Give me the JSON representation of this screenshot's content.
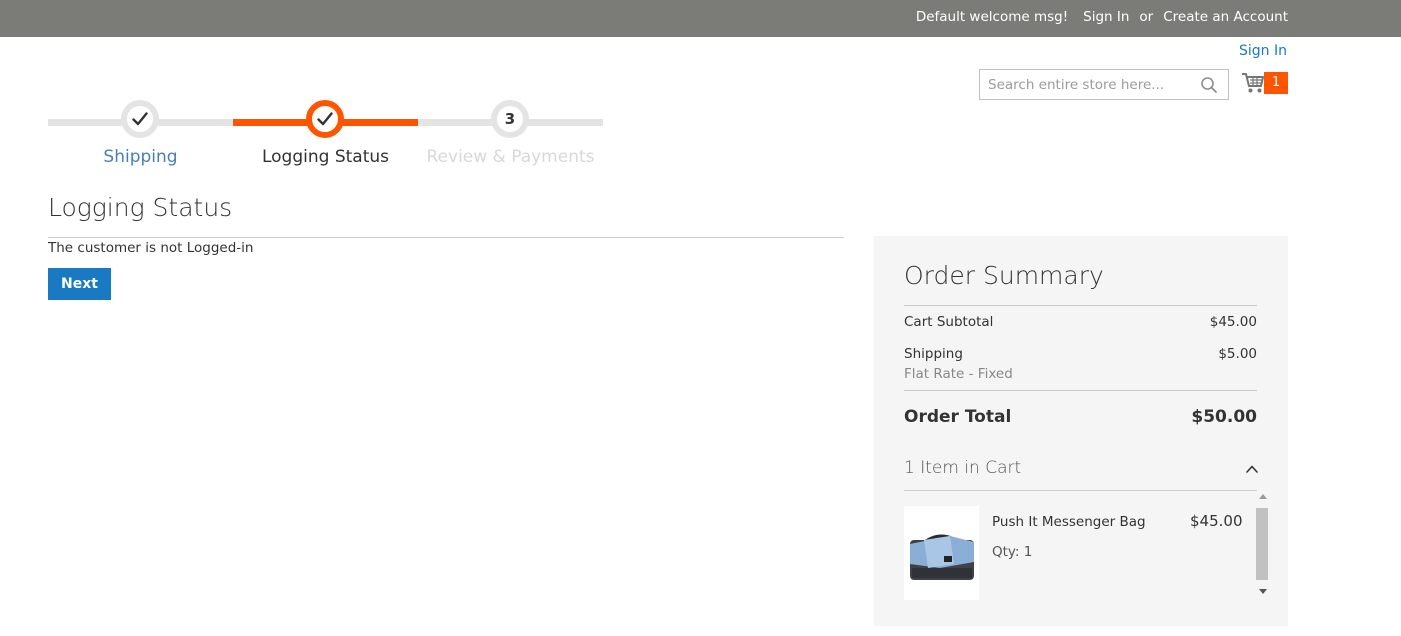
{
  "top_panel": {
    "welcome": "Default welcome msg!",
    "sign_in": "Sign In",
    "or": "or",
    "create_account": "Create an Account"
  },
  "header": {
    "sign_in": "Sign In",
    "search_placeholder": "Search entire store here...",
    "cart_count": "1",
    "accent_color": "#ff5501"
  },
  "progress": {
    "steps": [
      {
        "label": "Shipping",
        "state": "complete"
      },
      {
        "label": "Logging Status",
        "state": "active"
      },
      {
        "label": "Review & Payments",
        "state": "pending",
        "number": "3"
      }
    ]
  },
  "main": {
    "title": "Logging Status",
    "status_message": "The customer is not Logged-in",
    "next_label": "Next"
  },
  "summary": {
    "title": "Order Summary",
    "cart_subtotal_label": "Cart Subtotal",
    "cart_subtotal_value": "$45.00",
    "shipping_label": "Shipping",
    "shipping_value": "$5.00",
    "shipping_method": "Flat Rate - Fixed",
    "total_label": "Order Total",
    "total_value": "$50.00",
    "items_title": "1 Item in Cart",
    "items": [
      {
        "name": "Push It Messenger Bag",
        "price": "$45.00",
        "qty": "Qty: 1"
      }
    ]
  }
}
